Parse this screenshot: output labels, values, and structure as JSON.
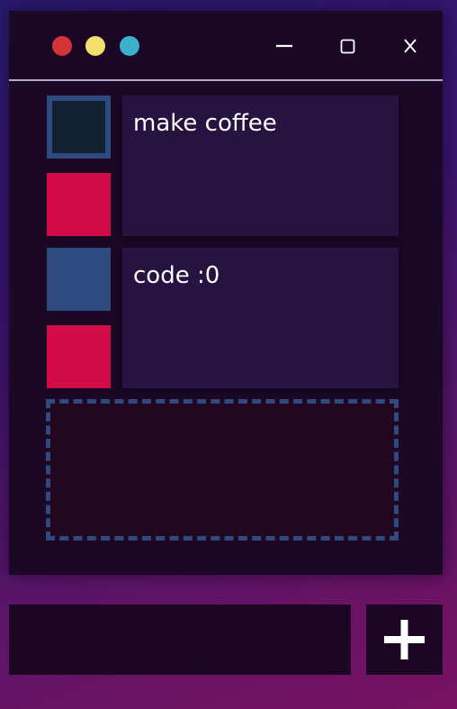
{
  "window": {
    "traffic_lights": [
      {
        "name": "close",
        "color": "#d23438"
      },
      {
        "name": "minimize",
        "color": "#f3df6d"
      },
      {
        "name": "zoom",
        "color": "#3bb1c9"
      }
    ],
    "controls": {
      "minimize_icon": "minus-icon",
      "maximize_icon": "square-icon",
      "close_icon": "x-icon"
    }
  },
  "todos": [
    {
      "text": "make coffee",
      "done_box_color": "#122033",
      "done_box_border": "#2e4a7e",
      "delete_box_color": "#d10b47"
    },
    {
      "text": "code :0",
      "done_box_color": "#2e4a7e",
      "done_box_border": "#2e4a7e",
      "delete_box_color": "#d10b47"
    }
  ],
  "drop_zone": {
    "border_color": "#2e4a7e"
  },
  "new_todo": {
    "value": "",
    "placeholder": "",
    "add_icon": "plus-icon"
  }
}
